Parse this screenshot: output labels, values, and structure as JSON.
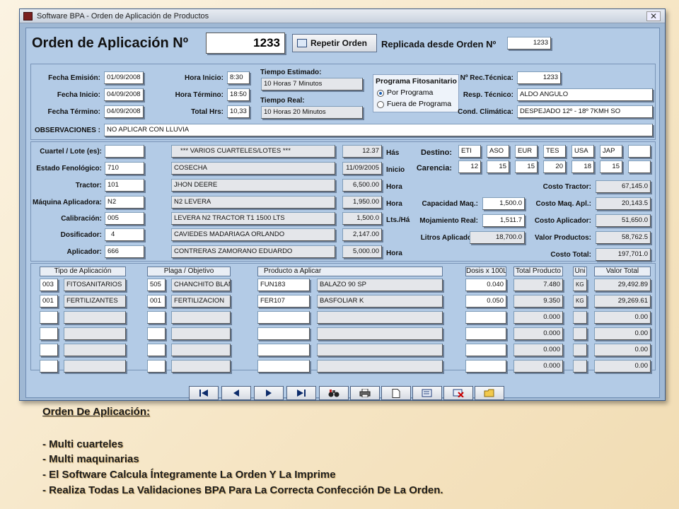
{
  "window": {
    "title": "Software BPA - Orden de Aplicación de Productos",
    "close": "✕"
  },
  "header": {
    "title": "Orden de Aplicación Nº",
    "order_number": "1233",
    "repeat_button": "Repetir Orden",
    "replicated_label": "Replicada desde Orden Nº",
    "replicated_value": "1233"
  },
  "dates": {
    "emision_label": "Fecha Emisión:",
    "emision": "01/09/2008",
    "inicio_label": "Fecha Inicio:",
    "inicio": "04/09/2008",
    "termino_label": "Fecha Término:",
    "termino": "04/09/2008",
    "hora_inicio_label": "Hora Inicio:",
    "hora_inicio": "8:30",
    "hora_termino_label": "Hora Término:",
    "hora_termino": "18:50",
    "total_hrs_label": "Total Hrs:",
    "total_hrs": "10,33",
    "tiempo_estimado_label": "Tiempo Estimado:",
    "tiempo_estimado": "10 Horas 7 Minutos",
    "tiempo_real_label": "Tiempo Real:",
    "tiempo_real": "10 Horas 20 Minutos"
  },
  "programa": {
    "title": "Programa Fitosanitario",
    "opt1": "Por Programa",
    "opt2": "Fuera de Programa"
  },
  "right_info": {
    "rec_label": "Nº Rec.Técnica:",
    "rec": "1233",
    "resp_label": "Resp. Técnico:",
    "resp": "ALDO ANGULO",
    "cond_label": "Cond. Climática:",
    "cond": "DESPEJADO 12º - 18º 7KMH SO"
  },
  "observaciones": {
    "label": "OBSERVACIONES :",
    "value": "NO APLICAR CON LLUVIA"
  },
  "details": {
    "cuartel_label": "Cuartel / Lote (es):",
    "cuartel_code": "",
    "cuartel_desc": "*** VARIOS CUARTELES/LOTES ***",
    "cuartel_num": "12.37",
    "cuartel_unit": "Hás",
    "estado_label": "Estado Fenológico:",
    "estado_code": "710",
    "estado_desc": "COSECHA",
    "estado_num": "11/09/2005",
    "estado_unit": "Inicio",
    "tractor_label": "Tractor:",
    "tractor_code": "101",
    "tractor_desc": "JHON DEERE",
    "tractor_num": "6,500.00",
    "tractor_unit": "Hora",
    "maquina_label": "Máquina Aplicadora:",
    "maquina_code": "N2",
    "maquina_desc": "N2 LEVERA",
    "maquina_num": "1,950.00",
    "maquina_unit": "Hora",
    "calib_label": "Calibración:",
    "calib_code": "005",
    "calib_desc": "LEVERA N2 TRACTOR T1 1500 LTS",
    "calib_num": "1,500.0",
    "calib_unit": "Lts./Há",
    "dosif_label": "Dosificador:",
    "dosif_code": "4",
    "dosif_desc": "CAVIEDES MADARIAGA ORLANDO",
    "dosif_num": "2,147.00",
    "dosif_unit": "",
    "aplic_label": "Aplicador:",
    "aplic_code": "666",
    "aplic_desc": "CONTRERAS ZAMORANO EDUARDO",
    "aplic_num": "5,000.00",
    "aplic_unit": "Hora"
  },
  "destino": {
    "label": "Destino:",
    "values": [
      "ETI",
      "ASO",
      "EUR",
      "TES",
      "USA",
      "JAP",
      ""
    ],
    "carencia_label": "Carencia:",
    "carencia": [
      "12",
      "15",
      "15",
      "20",
      "18",
      "15",
      ""
    ]
  },
  "calc": {
    "cap_label": "Capacidad Maq.:",
    "cap": "1,500.0",
    "moj_label": "Mojamiento Real:",
    "moj": "1,511.7",
    "litros_label": "Litros Aplicados:",
    "litros": "18,700.0"
  },
  "costs": {
    "tractor_label": "Costo Tractor:",
    "tractor": "67,145.0",
    "maq_label": "Costo Maq. Apl.:",
    "maq": "20,143.5",
    "aplicador_label": "Costo Aplicador:",
    "aplicador": "51,650.0",
    "productos_label": "Valor Productos:",
    "productos": "58,762.5",
    "total_label": "Costo Total:",
    "total": "197,701.0"
  },
  "grid": {
    "headers": {
      "tipo": "Tipo de Aplicación",
      "plaga": "Plaga / Objetivo",
      "producto": "Producto a Aplicar",
      "dosis": "Dosis x 100L",
      "total_prod": "Total Producto",
      "uni": "Uni",
      "valor": "Valor Total"
    },
    "rows": [
      {
        "tipo_code": "003",
        "tipo": "FITOSANITARIOS",
        "plaga_code": "505",
        "plaga": "CHANCHITO BLAN",
        "prod_code": "FUN183",
        "prod": "BALAZO 90 SP",
        "dosis": "0.040",
        "total": "7.480",
        "uni": "KG",
        "valor": "29,492.89"
      },
      {
        "tipo_code": "001",
        "tipo": "FERTILIZANTES",
        "plaga_code": "001",
        "plaga": "FERTILIZACION",
        "prod_code": "FER107",
        "prod": "BASFOLIAR K",
        "dosis": "0.050",
        "total": "9.350",
        "uni": "KG",
        "valor": "29,269.61"
      },
      {
        "tipo_code": "",
        "tipo": "",
        "plaga_code": "",
        "plaga": "",
        "prod_code": "",
        "prod": "",
        "dosis": "",
        "total": "0.000",
        "uni": "",
        "valor": "0.00"
      },
      {
        "tipo_code": "",
        "tipo": "",
        "plaga_code": "",
        "plaga": "",
        "prod_code": "",
        "prod": "",
        "dosis": "",
        "total": "0.000",
        "uni": "",
        "valor": "0.00"
      },
      {
        "tipo_code": "",
        "tipo": "",
        "plaga_code": "",
        "plaga": "",
        "prod_code": "",
        "prod": "",
        "dosis": "",
        "total": "0.000",
        "uni": "",
        "valor": "0.00"
      },
      {
        "tipo_code": "",
        "tipo": "",
        "plaga_code": "",
        "plaga": "",
        "prod_code": "",
        "prod": "",
        "dosis": "",
        "total": "0.000",
        "uni": "",
        "valor": "0.00"
      }
    ]
  },
  "caption": {
    "title": "Orden De Aplicación:",
    "lines": [
      "- Multi cuarteles",
      "- Multi maquinarias",
      "- El Software Calcula Íntegramente La Orden Y La Imprime",
      "- Realiza Todas La Validaciones BPA Para La Correcta Confección De La Orden."
    ]
  }
}
